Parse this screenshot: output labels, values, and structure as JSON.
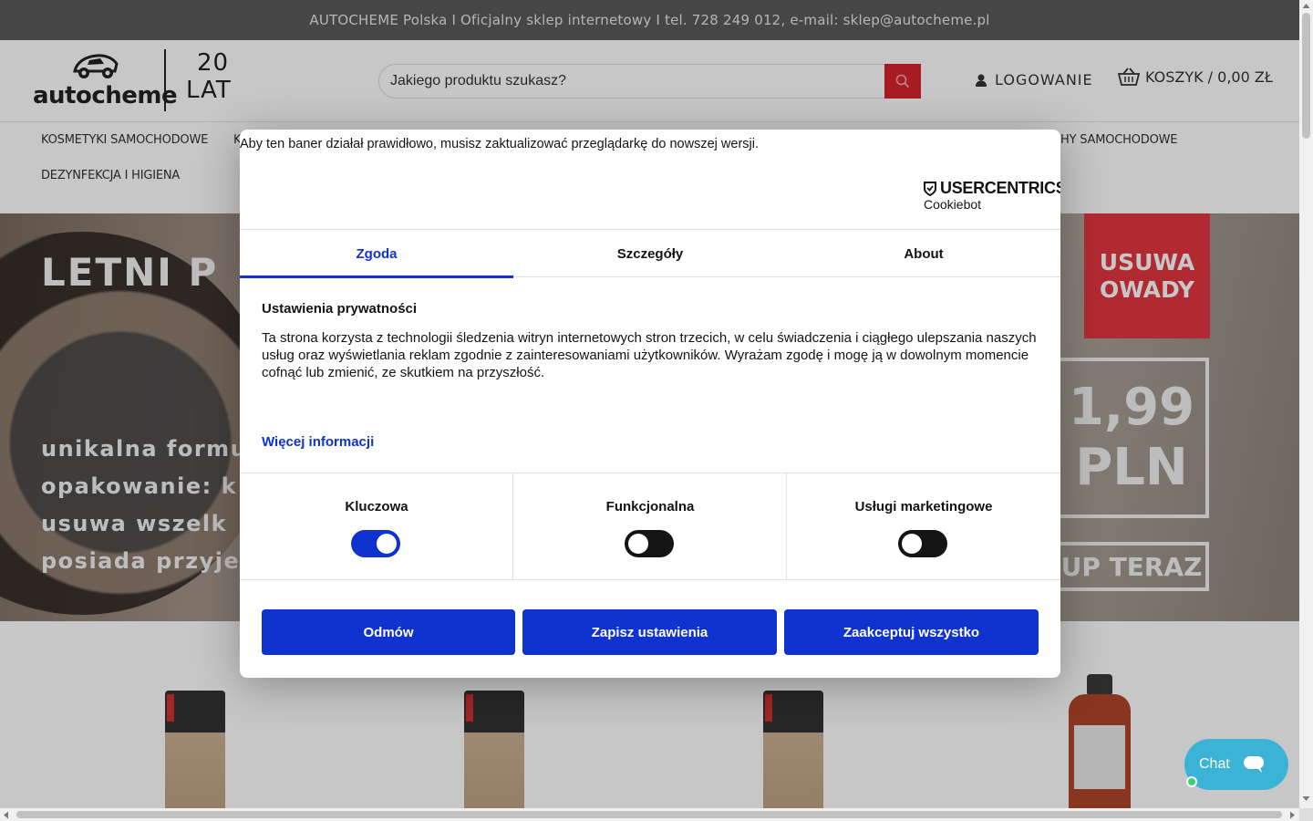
{
  "topbar": {
    "text": "AUTOCHEME Polska I Oficjalny sklep internetowy I tel. 728 249 012, e-mail: sklep@autocheme.pl"
  },
  "header": {
    "logo_word": "autocheme",
    "logo_years_num": "20",
    "logo_years_word": "LAT",
    "search_placeholder": "Jakiego produktu szukasz?",
    "login_label": "LOGOWANIE",
    "cart_label": "KOSZYK / 0,00 ZŁ"
  },
  "nav": {
    "items": [
      "KOSMETYKI SAMOCHODOWE",
      "K",
      "HY SAMOCHODOWE",
      "DEZYNFEKCJA I HIGIENA"
    ]
  },
  "hero": {
    "title": "LETNI P",
    "lines": [
      "unikalna formu",
      "opakowanie: k",
      "usuwa wszelk",
      "posiada przyje"
    ],
    "badge_line1": "USUWA",
    "badge_line2": "OWADY",
    "price_line1": "1,99",
    "price_line2": "PLN",
    "buy_label": "UP TERAZ"
  },
  "cookie": {
    "warning": "Aby ten baner działał prawidłowo, musisz zaktualizować przeglądarkę do nowszej wersji.",
    "brand": "USERCENTRICS",
    "brand_sub": "Cookiebot",
    "tabs": [
      "Zgoda",
      "Szczegóły",
      "About"
    ],
    "heading": "Ustawienia prywatności",
    "body": "Ta strona korzysta z technologii śledzenia witryn internetowych stron trzecich, w celu świadczenia i ciągłego ulepszania naszych usług oraz wyświetlania reklam zgodnie z zainteresowaniami użytkowników. Wyrażam zgodę i mogę ją w dowolnym momencie cofnąć lub zmienić, ze skutkiem na przyszłość.",
    "more_link": "Więcej informacji",
    "toggles": [
      {
        "label": "Kluczowa",
        "on": true
      },
      {
        "label": "Funkcjonalna",
        "on": false
      },
      {
        "label": "Usługi marketingowe",
        "on": false
      }
    ],
    "buttons": [
      "Odmów",
      "Zapisz ustawienia",
      "Zaakceptuj wszystko"
    ]
  },
  "chat": {
    "label": "Chat"
  },
  "colors": {
    "accent": "#1032cf",
    "search_button": "#d9232d",
    "badge": "#e5363f",
    "chat": "#3ab3d6"
  },
  "icons": [
    "search-icon",
    "user-icon",
    "basket-icon",
    "shield-icon",
    "chat-bubble-icon"
  ]
}
